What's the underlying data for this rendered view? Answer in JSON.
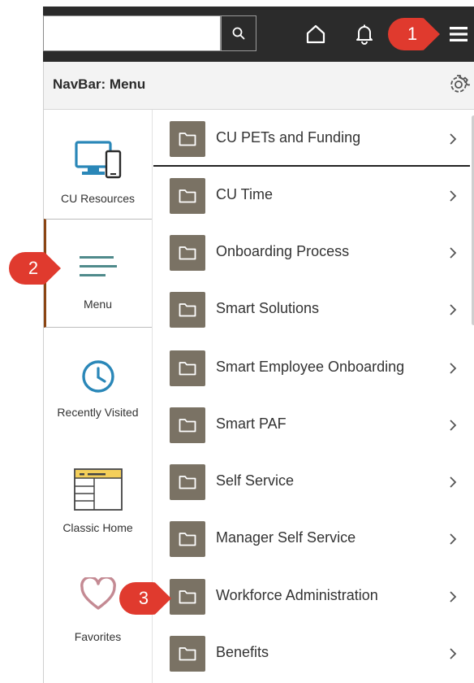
{
  "header": {
    "search_placeholder": "",
    "icons": [
      "search-icon",
      "home-icon",
      "bell-icon",
      "hamburger-icon"
    ]
  },
  "panel": {
    "title": "NavBar: Menu",
    "settings_icon": "gear-icon"
  },
  "navbar_tiles": [
    {
      "label": "CU Resources",
      "icon": "devices-icon"
    },
    {
      "label": "Menu",
      "icon": "menu-lines-icon",
      "active": true
    },
    {
      "label": "Recently Visited",
      "icon": "clock-icon"
    },
    {
      "label": "Classic Home",
      "icon": "classic-home-icon"
    },
    {
      "label": "Favorites",
      "icon": "heart-icon"
    }
  ],
  "menu_items": [
    {
      "label": "CU PETs and Funding",
      "icon": "folder-icon"
    },
    {
      "label": "CU Time",
      "icon": "folder-icon"
    },
    {
      "label": "Onboarding Process",
      "icon": "folder-icon"
    },
    {
      "label": "Smart Solutions",
      "icon": "folder-icon"
    },
    {
      "label": "Smart Employee Onboarding",
      "icon": "folder-icon"
    },
    {
      "label": "Smart PAF",
      "icon": "folder-icon"
    },
    {
      "label": "Self Service",
      "icon": "folder-icon"
    },
    {
      "label": "Manager Self Service",
      "icon": "folder-icon"
    },
    {
      "label": "Workforce Administration",
      "icon": "folder-icon"
    },
    {
      "label": "Benefits",
      "icon": "folder-icon"
    }
  ],
  "callouts": [
    {
      "number": "1",
      "target": "hamburger-icon"
    },
    {
      "number": "2",
      "target": "Menu tile"
    },
    {
      "number": "3",
      "target": "Workforce Administration"
    }
  ],
  "colors": {
    "header_bg": "#2b2b2b",
    "folder_bg": "#7a7264",
    "callout_red": "#e03a2e",
    "active_tile_border": "#8b4513",
    "icon_blue": "#2a87b8",
    "menu_icon_teal": "#4f8a8b"
  }
}
